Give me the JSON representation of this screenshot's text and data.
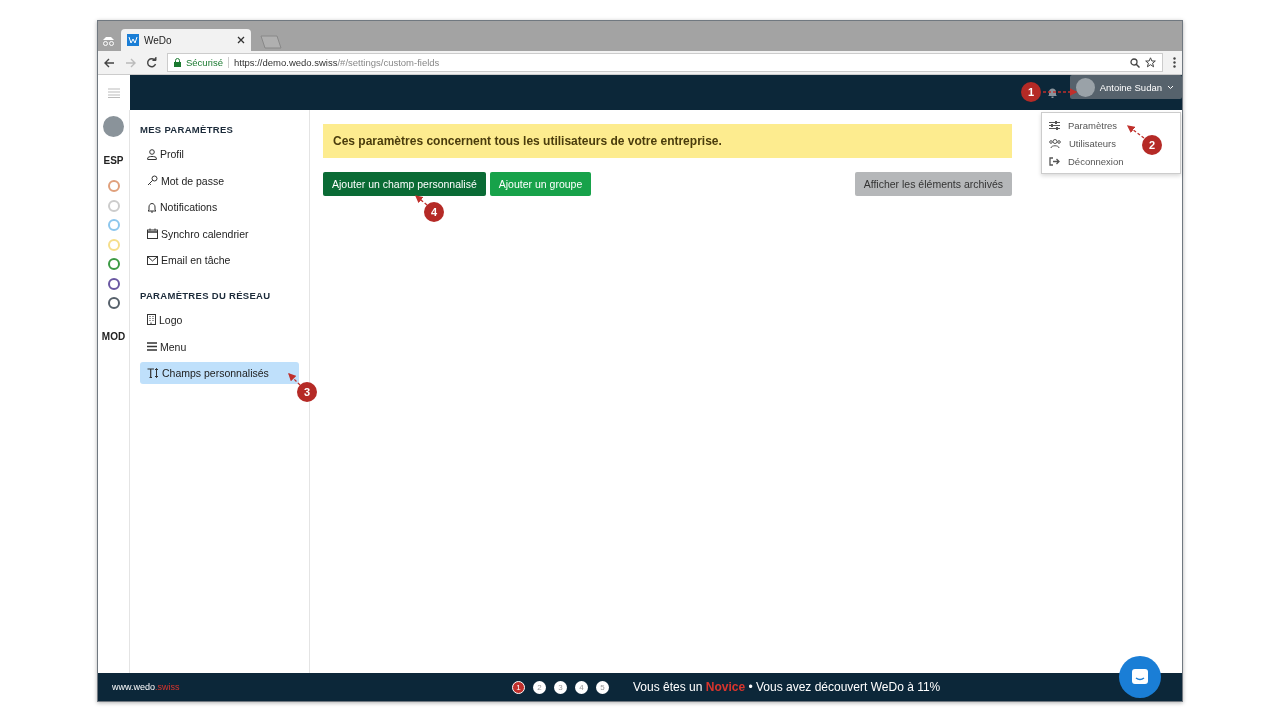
{
  "browser": {
    "tab_title": "WeDo",
    "secure_label": "Sécurisé",
    "url_host": "https://demo.wedo.swiss",
    "url_path": "/#/settings/custom-fields"
  },
  "topbar": {
    "user_name": "Antoine Sudan",
    "menu_open": true
  },
  "user_menu": [
    {
      "kind": "settings",
      "label": "Paramètres"
    },
    {
      "kind": "users",
      "label": "Utilisateurs"
    },
    {
      "kind": "logout",
      "label": "Déconnexion"
    }
  ],
  "rail": {
    "section_1": "ESP",
    "section_2": "MOD",
    "projects": [
      {
        "color": "#e0a07c"
      },
      {
        "color": "#cccccc"
      },
      {
        "color": "#8cc6ee"
      },
      {
        "color": "#f6de8a"
      },
      {
        "color": "#3c9a44"
      },
      {
        "color": "#6a58a2"
      },
      {
        "color": "#56606a"
      }
    ]
  },
  "sidebar": {
    "sections": [
      {
        "title": "MES PARAMÈTRES",
        "items": [
          {
            "kind": "user",
            "label": "Profil",
            "selected": false
          },
          {
            "kind": "key",
            "label": "Mot de passe",
            "selected": false
          },
          {
            "kind": "bell",
            "label": "Notifications",
            "selected": false
          },
          {
            "kind": "calendar",
            "label": "Synchro calendrier",
            "selected": false
          },
          {
            "kind": "mail",
            "label": "Email en tâche",
            "selected": false
          }
        ]
      },
      {
        "title": "PARAMÈTRES DU RÉSEAU",
        "items": [
          {
            "kind": "building",
            "label": "Logo",
            "selected": false
          },
          {
            "kind": "menu",
            "label": "Menu",
            "selected": false
          },
          {
            "kind": "text",
            "label": "Champs personnalisés",
            "selected": true
          }
        ]
      }
    ]
  },
  "notice": "Ces paramètres concernent tous les utilisateurs de votre entreprise.",
  "buttons": [
    {
      "kind": "primary",
      "label": "Ajouter un champ personnalisé"
    },
    {
      "kind": "success",
      "label": "Ajouter un groupe"
    },
    {
      "kind": "secondary",
      "label": "Afficher les éléments archivés"
    }
  ],
  "footer": {
    "site": "www.wedo",
    "site_suffix": ".swiss",
    "steps": [
      {
        "label": "1",
        "selected": true
      },
      {
        "label": "2",
        "selected": false
      },
      {
        "label": "3",
        "selected": false
      },
      {
        "label": "4",
        "selected": false
      },
      {
        "label": "5",
        "selected": false
      }
    ],
    "progress_before": "Vous êtes un",
    "level_name": "Novice",
    "progress_after": "• Vous avez découvert WeDo à 11%"
  },
  "callouts": [
    {
      "label": "1"
    },
    {
      "label": "2"
    },
    {
      "label": "3"
    },
    {
      "label": "4"
    }
  ]
}
